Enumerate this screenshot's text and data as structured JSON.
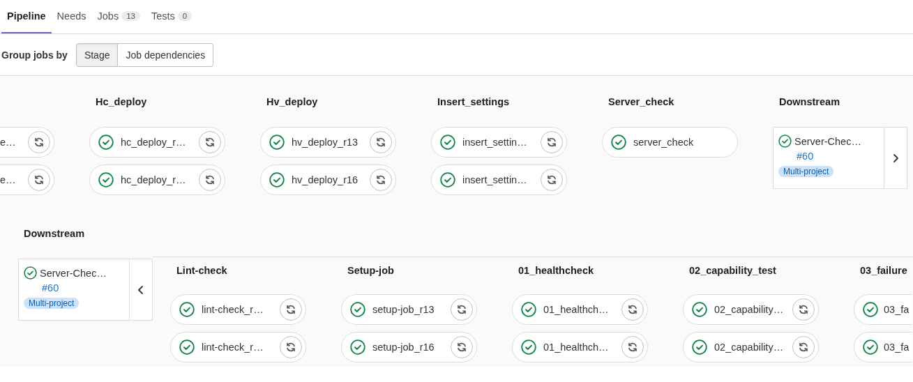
{
  "tabs": [
    {
      "label": "Pipeline",
      "selected": true
    },
    {
      "label": "Needs",
      "selected": false
    },
    {
      "label": "Jobs",
      "count": "13",
      "selected": false
    },
    {
      "label": "Tests",
      "count": "0",
      "selected": false
    }
  ],
  "group_by": {
    "label": "Group jobs by",
    "options": [
      {
        "label": "Stage",
        "selected": true
      },
      {
        "label": "Job dependencies",
        "selected": false
      }
    ]
  },
  "pipeline": {
    "stages": [
      {
        "kind": "partial_left",
        "jobs": [
          {
            "name": "e…",
            "retry": true
          },
          {
            "name": "e…",
            "retry": true
          }
        ]
      },
      {
        "kind": "stage",
        "name": "Hc_deploy",
        "jobs": [
          {
            "name": "hc_deploy_r…",
            "retry": true
          },
          {
            "name": "hc_deploy_r…",
            "retry": true
          }
        ]
      },
      {
        "kind": "stage",
        "name": "Hv_deploy",
        "jobs": [
          {
            "name": "hv_deploy_r13",
            "retry": true
          },
          {
            "name": "hv_deploy_r16",
            "retry": true
          }
        ]
      },
      {
        "kind": "stage",
        "name": "Insert_settings",
        "jobs": [
          {
            "name": "insert_settin…",
            "retry": true
          },
          {
            "name": "insert_settin…",
            "retry": true
          }
        ]
      },
      {
        "kind": "stage",
        "name": "Server_check",
        "jobs": [
          {
            "name": "server_check",
            "retry": false
          }
        ]
      },
      {
        "kind": "downstream",
        "name": "Downstream",
        "card": {
          "title": "Server-Chec…",
          "number": "#60",
          "badge": "Multi-project",
          "expanded": false
        }
      }
    ]
  },
  "linked_pipeline": {
    "name": "Downstream",
    "card": {
      "title": "Server-Chec…",
      "number": "#60",
      "badge": "Multi-project",
      "expanded": true
    },
    "stages": [
      {
        "kind": "stage",
        "name": "Lint-check",
        "jobs": [
          {
            "name": "lint-check_r…",
            "retry": true
          },
          {
            "name": "lint-check_r…",
            "retry": true
          }
        ]
      },
      {
        "kind": "stage",
        "name": "Setup-job",
        "jobs": [
          {
            "name": "setup-job_r13",
            "retry": true
          },
          {
            "name": "setup-job_r16",
            "retry": true
          }
        ]
      },
      {
        "kind": "stage",
        "name": "01_healthcheck",
        "jobs": [
          {
            "name": "01_healthch…",
            "retry": true
          },
          {
            "name": "01_healthch…",
            "retry": true
          }
        ]
      },
      {
        "kind": "stage",
        "name": "02_capability_test",
        "jobs": [
          {
            "name": "02_capability…",
            "retry": true
          },
          {
            "name": "02_capability…",
            "retry": true
          }
        ]
      },
      {
        "kind": "partial_right",
        "name": "03_failure",
        "jobs": [
          {
            "name": "03_fa"
          },
          {
            "name": "03_fa"
          }
        ]
      }
    ]
  }
}
